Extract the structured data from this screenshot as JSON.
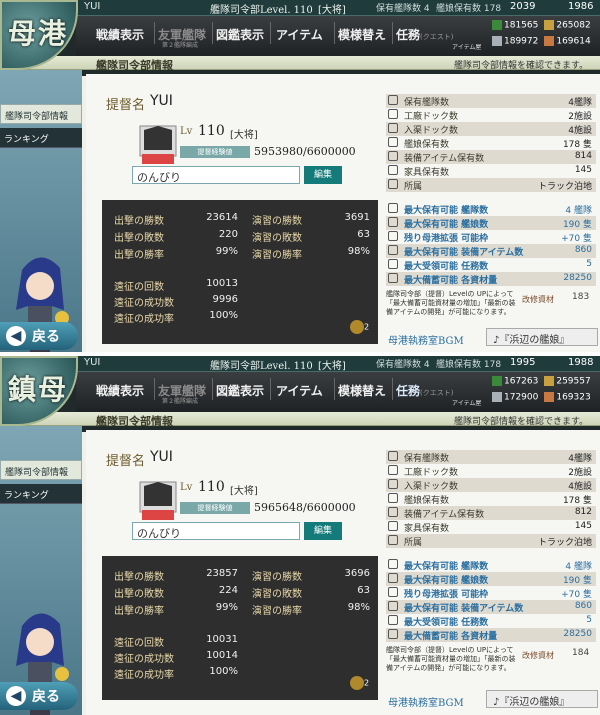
{
  "common": {
    "badge_top": "母港",
    "badge_bottom": "鎮母",
    "nav": {
      "record": "戦績表示",
      "org": "友軍艦隊",
      "org_sub": "第２艦隊編成",
      "book": "図鑑表示",
      "item": "アイテム",
      "remodel": "模様替え",
      "quest": "任務",
      "quest_sub": "(クエスト)",
      "item_shop": "アイテム屋"
    },
    "sub_title": "艦隊司令部情報",
    "sub_msg": "艦隊司令部情報を確認できます。",
    "side_info": "艦隊司令部情報",
    "side_rank": "ランキング",
    "back": "戻る",
    "admiral_label": "提督名",
    "lv_label": "Lv",
    "exp_label": "提督経験値",
    "edit": "編集",
    "stat_labels": {
      "sortie_wins": "出撃の勝数",
      "sortie_losses": "出撃の敗数",
      "sortie_rate": "出撃の勝率",
      "pvp_wins": "演習の勝数",
      "pvp_losses": "演習の敗数",
      "pvp_rate": "演習の勝率",
      "exp_count": "遠征の回数",
      "exp_success": "遠征の成功数",
      "exp_rate": "遠征の成功率"
    },
    "info_labels": {
      "ships": "保有艦隊数",
      "build_dock": "工廠ドック数",
      "repair_dock": "入渠ドック数",
      "ships_owned": "艦娘保有数",
      "equip_owned": "装備アイテム保有数",
      "furniture": "家具保有数",
      "base": "所属",
      "max_fleets": "最大保有可能 艦隊数",
      "max_ships": "最大保有可能 艦娘数",
      "ext": "残り母港拡張 可能枠",
      "max_equip": "最大保有可能 装備アイテム数",
      "max_quest": "最大受領可能 任務数",
      "max_res": "最大備蓄可能 各資材量"
    },
    "note": "艦隊司令部（提督）Levelの UPによって「最大備蓄可能資材量の増加」「最新の装備アイテムの開発」が可能になります。",
    "kai_label": "改修資材",
    "bgm_label": "母港執務室BGM",
    "bgm_value": "♪『浜辺の艦娘』"
  },
  "panels": [
    {
      "top": {
        "name": "YUI",
        "level_text": "艦隊司令部Level. 110",
        "rank": "[大将]",
        "fleets": "保有艦隊数 4",
        "ships": "艦娘保有数 178",
        "bucket": "2039",
        "kai": "1986"
      },
      "res": {
        "fuel": "181565",
        "ammo": "265082",
        "steel": "189972",
        "baux": "169614"
      },
      "admiral": {
        "name": "YUI",
        "level": "110",
        "rank": "[大将]",
        "exp": "5953980/6600000",
        "comment": "のんびり"
      },
      "stats": {
        "sortie_wins": "23614",
        "sortie_losses": "220",
        "sortie_rate": "99%",
        "pvp_wins": "3691",
        "pvp_losses": "63",
        "pvp_rate": "98%",
        "exp_count": "10013",
        "exp_success": "9996",
        "exp_rate": "100%",
        "medals": "2"
      },
      "info": {
        "ships": "4艦隊",
        "build_dock": "2施設",
        "repair_dock": "4施設",
        "ships_owned": "178 隻",
        "equip_owned": "814",
        "furniture": "145",
        "base": "トラック泊地",
        "max_fleets": "4 艦隊",
        "max_ships": "190 隻",
        "ext": "+70 隻",
        "max_equip": "860",
        "max_quest": "5",
        "max_res": "28250",
        "kai": "183"
      }
    },
    {
      "top": {
        "name": "YUI",
        "level_text": "艦隊司令部Level. 110",
        "rank": "[大将]",
        "fleets": "保有艦隊数 4",
        "ships": "艦娘保有数 178",
        "bucket": "1995",
        "kai": "1988"
      },
      "res": {
        "fuel": "167263",
        "ammo": "259557",
        "steel": "172900",
        "baux": "169323"
      },
      "admiral": {
        "name": "YUI",
        "level": "110",
        "rank": "[大将]",
        "exp": "5965648/6600000",
        "comment": "のんびり"
      },
      "stats": {
        "sortie_wins": "23857",
        "sortie_losses": "224",
        "sortie_rate": "99%",
        "pvp_wins": "3696",
        "pvp_losses": "63",
        "pvp_rate": "98%",
        "exp_count": "10031",
        "exp_success": "10014",
        "exp_rate": "100%",
        "medals": "2"
      },
      "info": {
        "ships": "4艦隊",
        "build_dock": "2施設",
        "repair_dock": "4施設",
        "ships_owned": "178 隻",
        "equip_owned": "812",
        "furniture": "145",
        "base": "トラック泊地",
        "max_fleets": "4 艦隊",
        "max_ships": "190 隻",
        "ext": "+70 隻",
        "max_equip": "860",
        "max_quest": "5",
        "max_res": "28250",
        "kai": "184"
      }
    }
  ],
  "colors": {
    "accent": "#157a7a",
    "blue_text": "#2a6fa0",
    "stats_bg": "#2e2e2e"
  }
}
